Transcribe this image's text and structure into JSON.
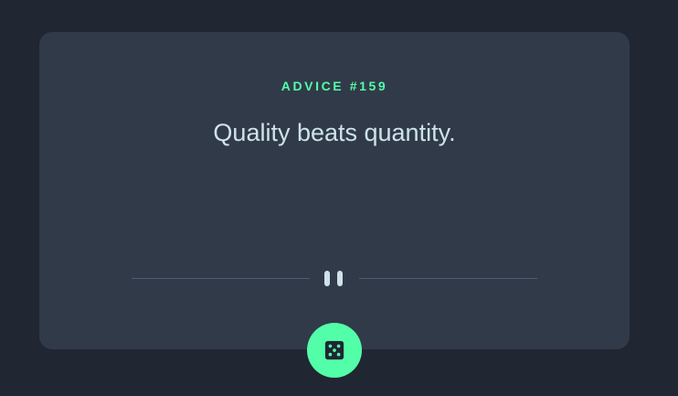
{
  "advice": {
    "label": "ADVICE #159",
    "text": "Quality beats quantity."
  },
  "icons": {
    "divider": "pause-icon",
    "button": "dice-icon"
  },
  "colors": {
    "page_background": "#202632",
    "card_background": "#313a49",
    "accent": "#52ffa8",
    "text": "#cee3e9",
    "divider": "#4f5d74"
  }
}
